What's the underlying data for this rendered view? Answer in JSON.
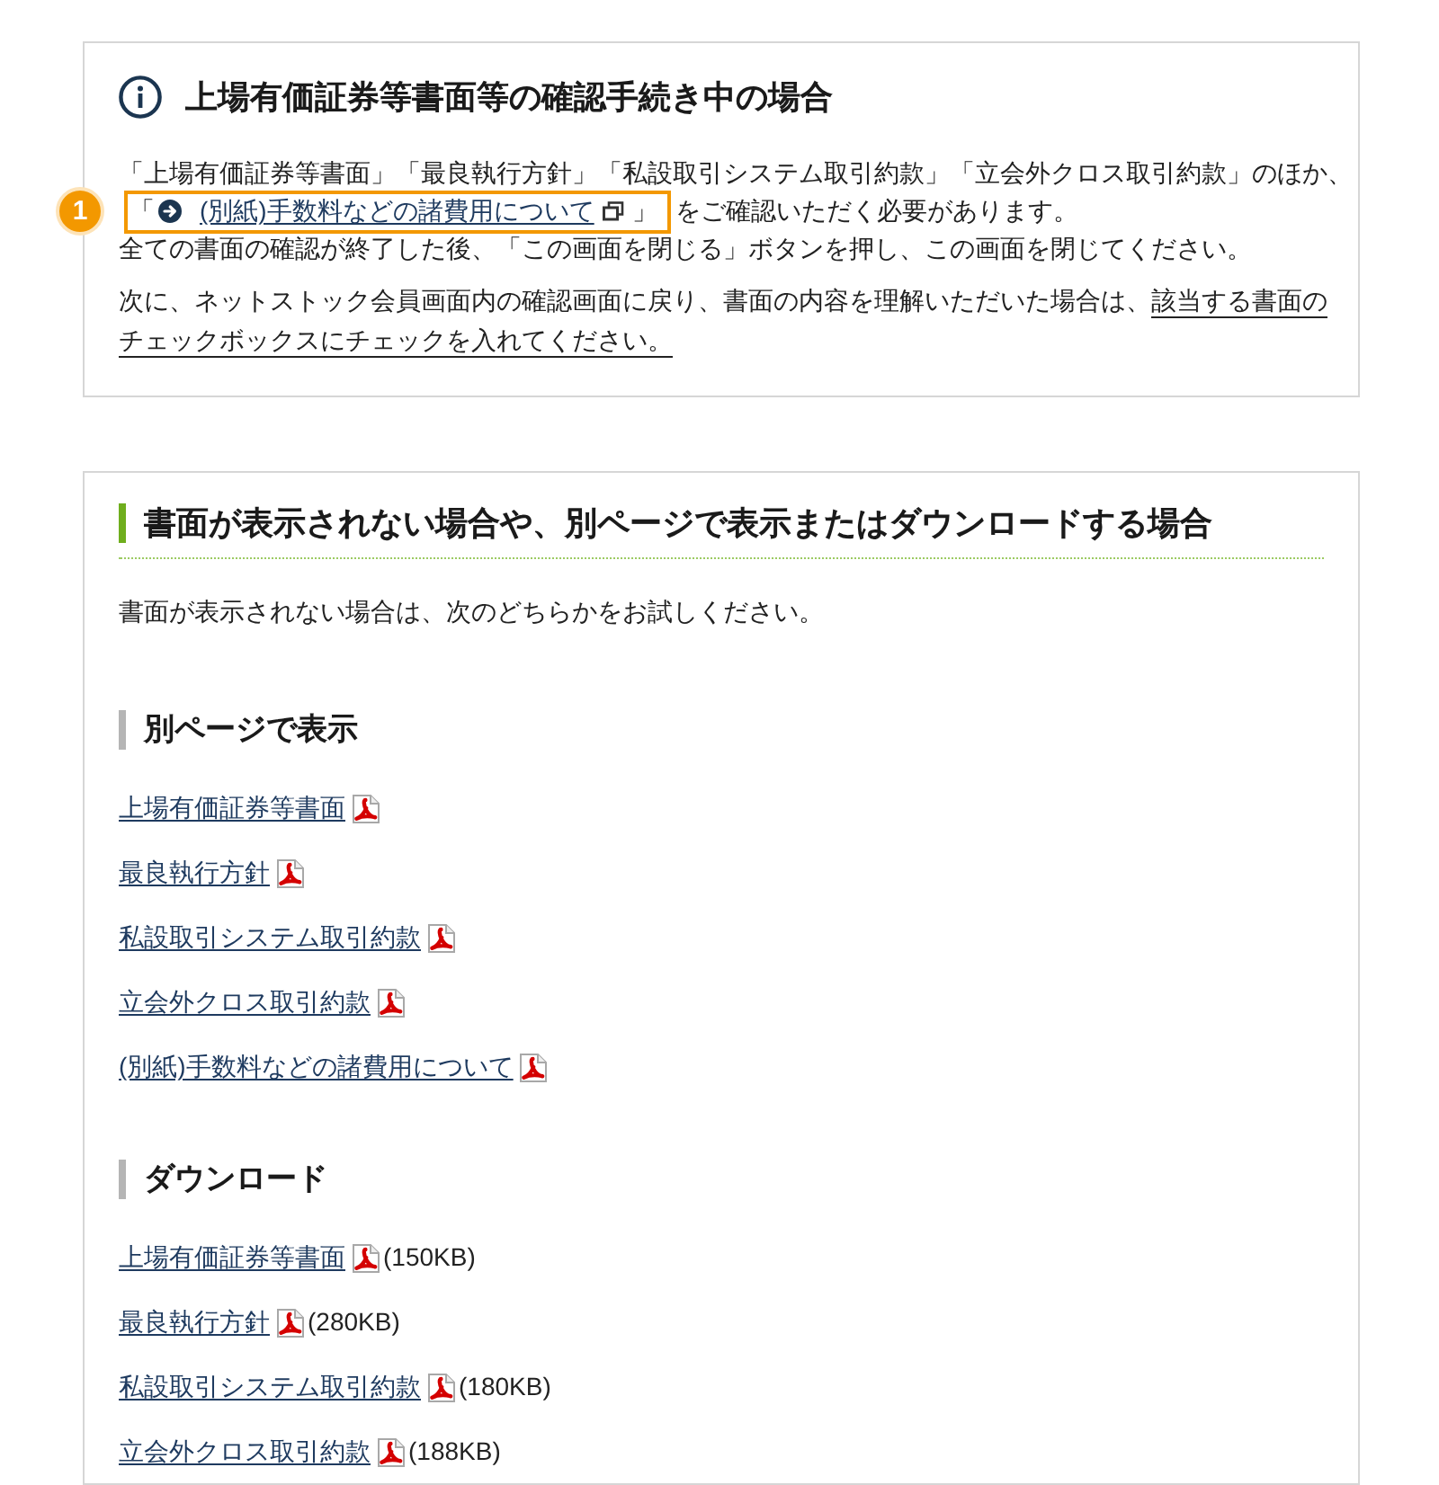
{
  "notice": {
    "title": "上場有価証券等書面等の確認手続き中の場合",
    "intro": "「上場有価証券等書面」「最良執行方針」「私設取引システム取引約款」「立会外クロス取引約款」のほか、",
    "highlight": {
      "number": "1",
      "open_bracket": "「",
      "link": "(別紙)手数料などの諸費用について",
      "close_bracket": "」"
    },
    "intro_end": "をご確認いただく必要があります。",
    "close_instruction": "全ての書面の確認が終了した後、「この画面を閉じる」ボタンを押し、この画面を閉じてください。",
    "next_instruction": {
      "text": "次に、ネットストック会員画面内の確認画面に戻り、書面の内容を理解いただいた場合は、",
      "underlined": "該当する書面のチェックボックスにチェックを入れてください。"
    }
  },
  "help": {
    "title": "書面が表示されない場合や、別ページで表示またはダウンロードする場合",
    "description": "書面が表示されない場合は、次のどちらかをお試しください。",
    "sections": [
      {
        "title": "別ページで表示",
        "links": [
          {
            "label": "上場有価証券等書面"
          },
          {
            "label": "最良執行方針"
          },
          {
            "label": "私設取引システム取引約款"
          },
          {
            "label": "立会外クロス取引約款"
          },
          {
            "label": "(別紙)手数料などの諸費用について"
          }
        ]
      },
      {
        "title": "ダウンロード",
        "links": [
          {
            "label": "上場有価証券等書面",
            "size": "(150KB)"
          },
          {
            "label": "最良執行方針",
            "size": "(280KB)"
          },
          {
            "label": "私設取引システム取引約款",
            "size": "(180KB)"
          },
          {
            "label": "立会外クロス取引約款",
            "size": "(188KB)"
          }
        ]
      }
    ]
  }
}
